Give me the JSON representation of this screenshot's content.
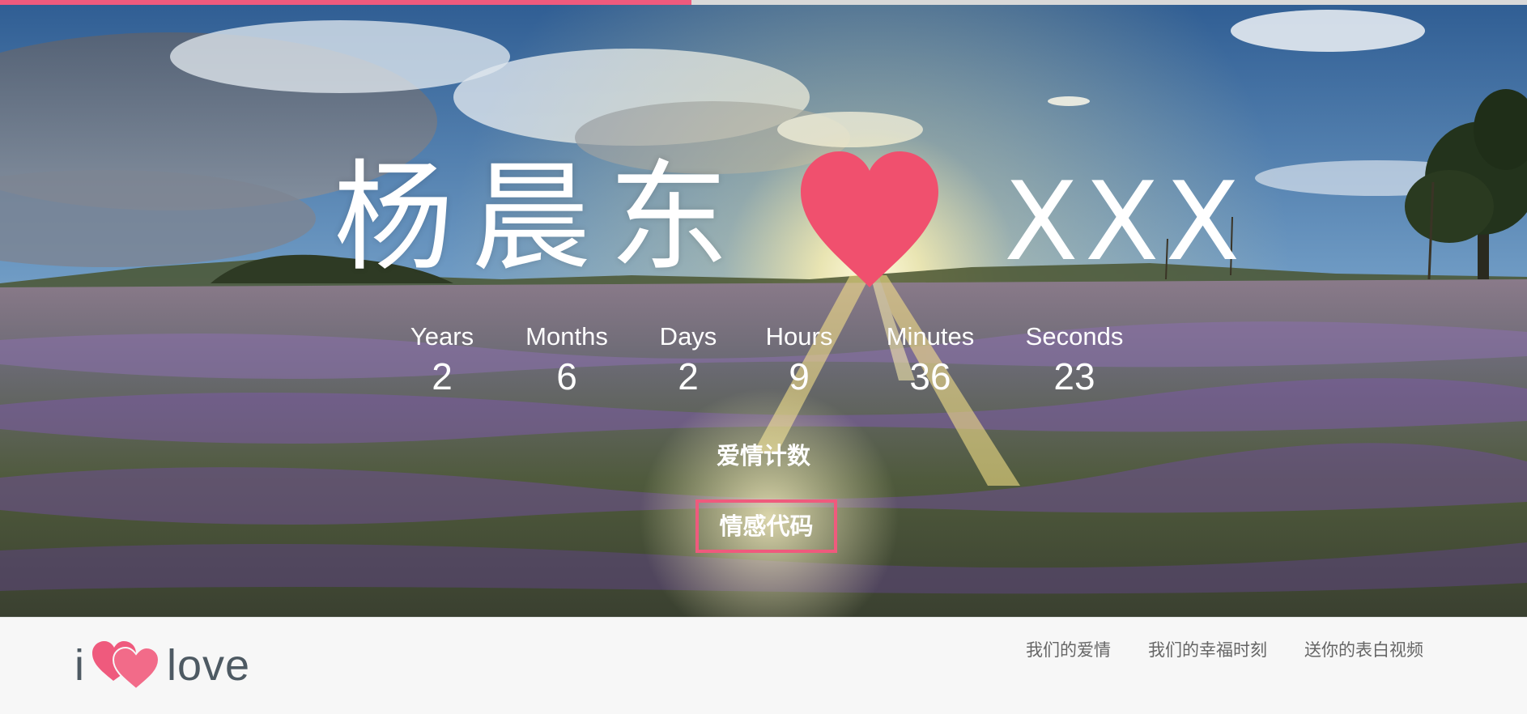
{
  "progress": {
    "fraction": 0.453,
    "fill_color": "#ef5a7d",
    "track_color": "#d9d9d9"
  },
  "hero": {
    "name_left": "杨晨东",
    "name_right": "XXX",
    "heart_icon": "heart-icon",
    "heart_color": "#f0506e"
  },
  "counter": {
    "units": [
      {
        "label": "Years",
        "value": "2"
      },
      {
        "label": "Months",
        "value": "6"
      },
      {
        "label": "Days",
        "value": "2"
      },
      {
        "label": "Hours",
        "value": "9"
      },
      {
        "label": "Minutes",
        "value": "36"
      },
      {
        "label": "Seconds",
        "value": "23"
      }
    ]
  },
  "love_count_label": "爱情计数",
  "code_button_label": "情感代码",
  "footer": {
    "logo": {
      "prefix": "i",
      "word": "love",
      "icon": "double-heart-icon",
      "heart_color": "#ef5a7d"
    },
    "nav": [
      {
        "label": "我们的爱情"
      },
      {
        "label": "我们的幸福时刻"
      },
      {
        "label": "送你的表白视频"
      }
    ]
  }
}
